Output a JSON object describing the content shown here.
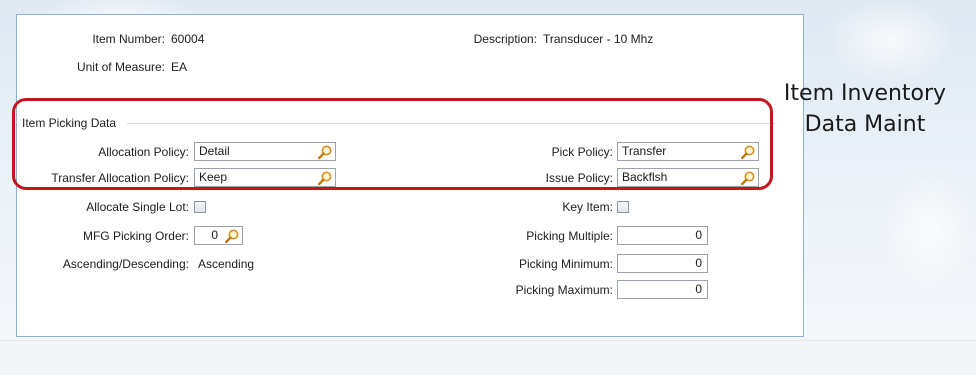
{
  "header": {
    "item_number_label": "Item Number:",
    "item_number_value": "60004",
    "uom_label": "Unit of Measure:",
    "uom_value": "EA",
    "description_label": "Description:",
    "description_value": "Transducer - 10 Mhz"
  },
  "picking": {
    "group_title": "Item Picking Data",
    "allocation_policy_label": "Allocation Policy:",
    "allocation_policy_value": "Detail",
    "transfer_allocation_policy_label": "Transfer Allocation Policy:",
    "transfer_allocation_policy_value": "Keep",
    "pick_policy_label": "Pick Policy:",
    "pick_policy_value": "Transfer",
    "issue_policy_label": "Issue Policy:",
    "issue_policy_value": "Backflsh"
  },
  "options": {
    "allocate_single_lot_label": "Allocate Single Lot:",
    "allocate_single_lot_checked": false,
    "mfg_picking_order_label": "MFG Picking Order:",
    "mfg_picking_order_value": "0",
    "ascending_descending_label": "Ascending/Descending:",
    "ascending_descending_value": "Ascending",
    "key_item_label": "Key Item:",
    "key_item_checked": false,
    "picking_multiple_label": "Picking Multiple:",
    "picking_multiple_value": "0",
    "picking_minimum_label": "Picking Minimum:",
    "picking_minimum_value": "0",
    "picking_maximum_label": "Picking Maximum:",
    "picking_maximum_value": "0"
  },
  "callout": {
    "line1": "Item Inventory",
    "line2": "Data Maint"
  },
  "colors": {
    "highlight": "#c4161c",
    "panel_border": "#8fb1d3"
  },
  "icons": {
    "lookup": "magnifier-icon"
  }
}
